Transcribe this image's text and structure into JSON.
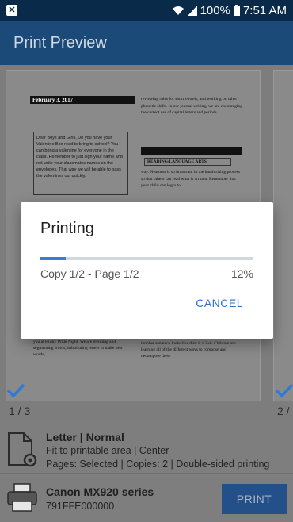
{
  "status_bar": {
    "battery": "100%",
    "time": "7:51 AM"
  },
  "app_bar": {
    "title": "Print Preview"
  },
  "preview": {
    "date_header": "February 3, 2017",
    "letter_text": "Dear Boys and Girls, Do you have your Valentine Box read to bring to school? You can bring a valentine for everyone in the class. Remember to just sign your name and not write your classmates names on the envelopes. That way we will be able to pass the valentines out quickly.",
    "right_col_text": "reviewing rules for short vowels, and working on other phonetic skills. In our journal writing, we are encouraging the correct use of capital letters and periods.",
    "section_head": "READING/LANGUAGE ARTS",
    "right_col_text2": "way. Neatness is so important in the handwriting process so that others can read what is written. Remember that your child can login to",
    "bottom_left_text": "This work we worked on specific projects to share with you at Husky Pride Night. We are blending and segmenting words, substituting letters to make new words,",
    "bottom_right_text": "number sentence looks like this: 8 = 2+6. Children are learning all of the different ways to compose and decompose these",
    "page_counter": "1 / 3",
    "page_counter_2": "2 /"
  },
  "settings": {
    "paper": "Letter | Normal",
    "fit": "Fit to printable area | Center",
    "pages": "Pages: Selected | Copies: 2 | Double-sided printing",
    "printer_name": "Canon MX920 series",
    "printer_id": "791FFE000000",
    "print_label": "PRINT"
  },
  "dialog": {
    "title": "Printing",
    "status": "Copy 1/2 - Page 1/2",
    "percent": "12%",
    "progress": 0.12,
    "cancel_label": "CANCEL"
  },
  "colors": {
    "accent": "#2a6fce",
    "app_bar": "#1b4a78",
    "check": "#2c7bd8"
  }
}
